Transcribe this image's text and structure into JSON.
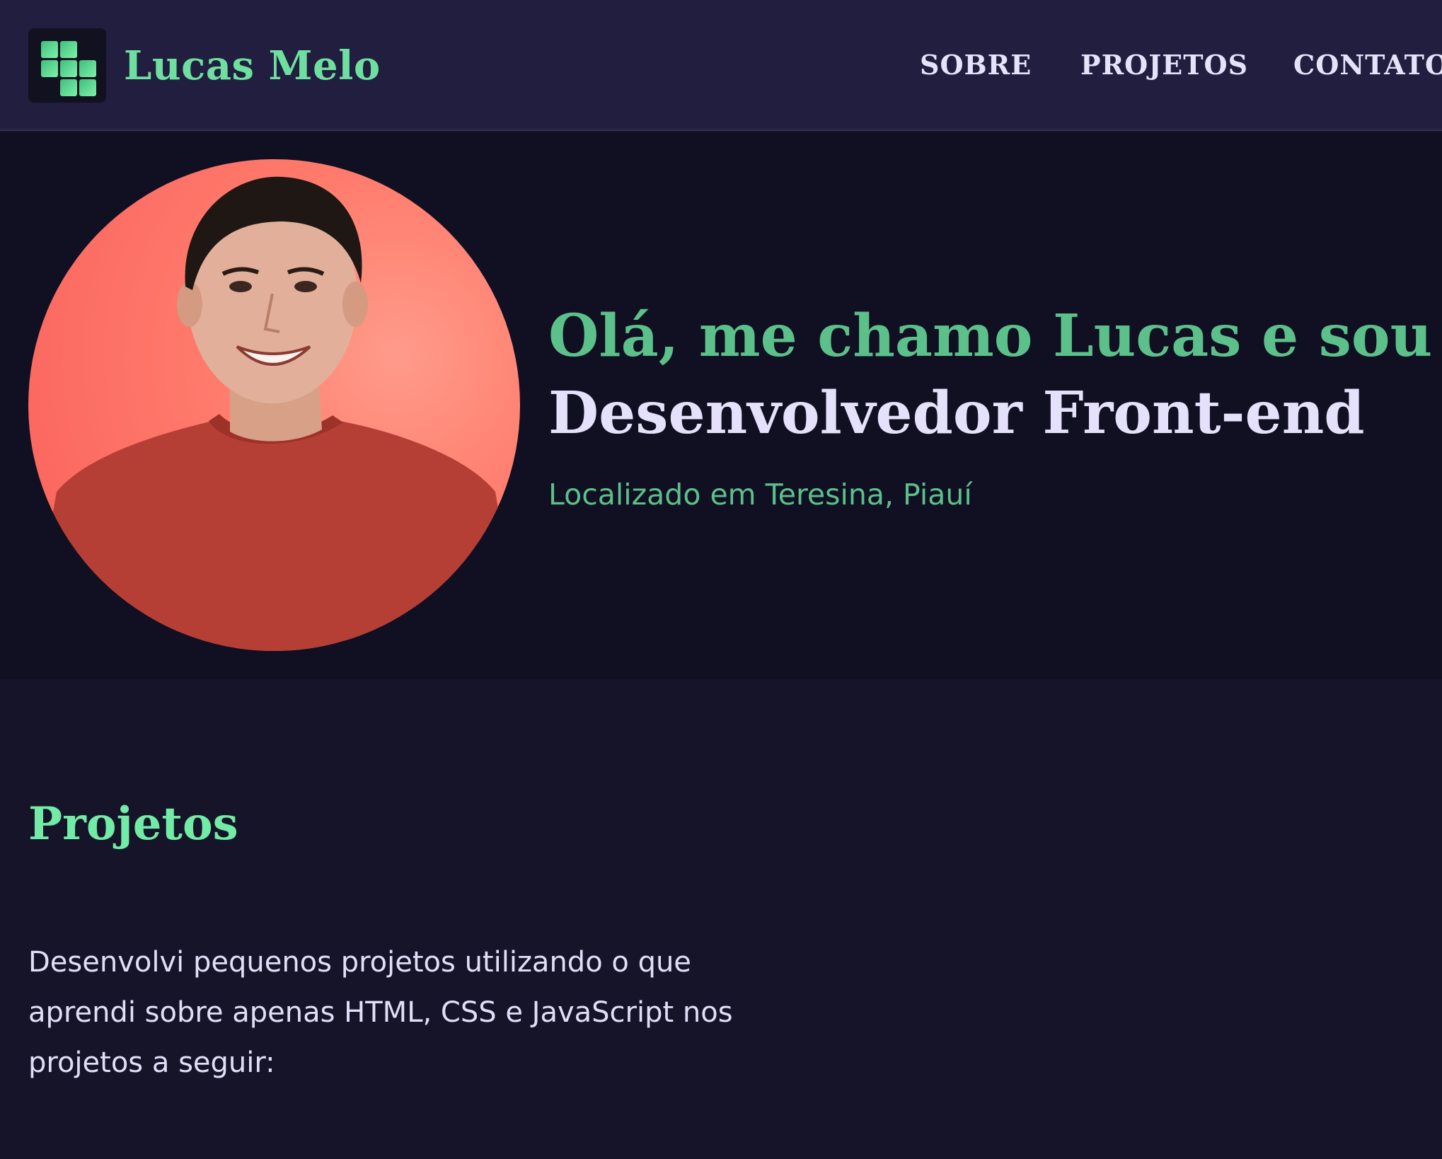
{
  "header": {
    "logo_icon": "grid-blocks-icon",
    "brand": "Lucas Melo",
    "nav": [
      {
        "label": "SOBRE"
      },
      {
        "label": "PROJETOS"
      },
      {
        "label": "CONTATO"
      }
    ]
  },
  "hero": {
    "greeting": "Olá, me chamo Lucas e sou",
    "role": "Desenvolvedor Front-end",
    "location": "Localizado em Teresina, Piauí"
  },
  "projects": {
    "title": "Projetos",
    "description": "Desenvolvi pequenos projetos utilizando o que aprendi sobre apenas HTML, CSS e JavaScript nos projetos a seguir:"
  },
  "colors": {
    "header_bg": "#211e3f",
    "hero_bg": "#110f22",
    "section_bg": "#161429",
    "accent_green": "#5cc08a",
    "title_green": "#72eba6",
    "light_text": "#e5e1fb",
    "avatar_bg": "#ff7b6c"
  }
}
